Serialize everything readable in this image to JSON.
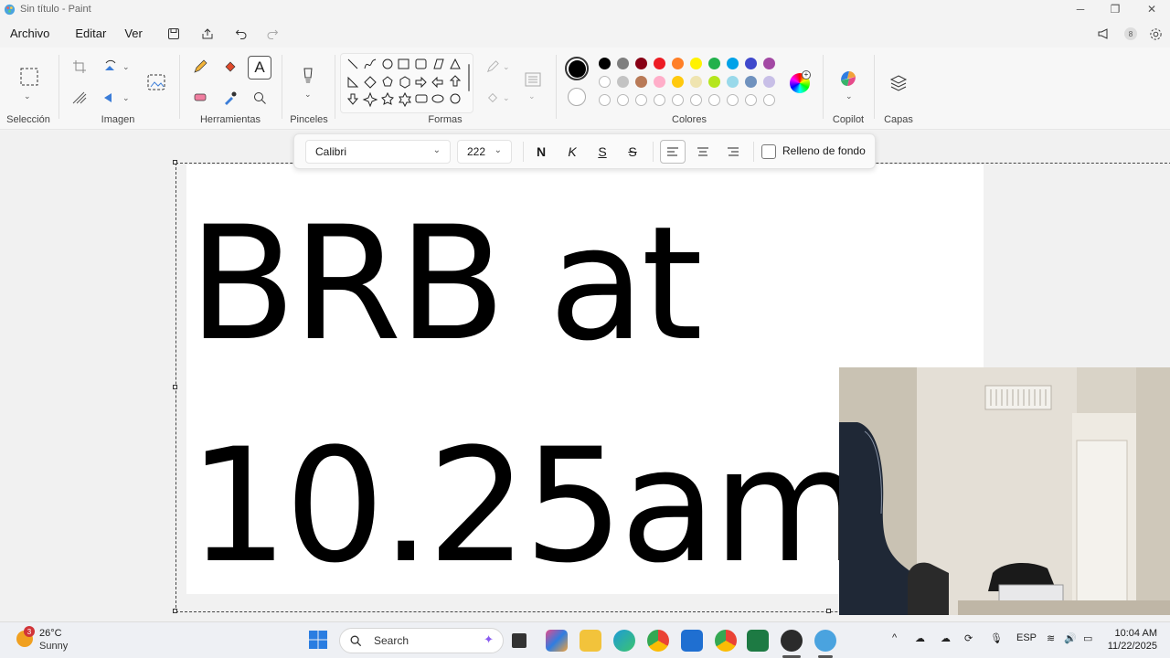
{
  "window": {
    "title": "Sin título - Paint"
  },
  "menu": {
    "items": [
      "Archivo",
      "Editar",
      "Ver"
    ]
  },
  "ribbon": {
    "groups": {
      "selection": "Selección",
      "image": "Imagen",
      "tools": "Herramientas",
      "brushes": "Pinceles",
      "shapes": "Formas",
      "colors": "Colores",
      "copilot": "Copilot",
      "layers": "Capas"
    },
    "palette_row1": [
      "#000000",
      "#7f7f7f",
      "#880015",
      "#ed1c24",
      "#ff7f27",
      "#fff200",
      "#22b14c",
      "#00a2e8",
      "#3f48cc",
      "#a349a4"
    ],
    "palette_row2": [
      "#ffffff",
      "#c3c3c3",
      "#b97a57",
      "#ffaec9",
      "#ffc90e",
      "#efe4b0",
      "#b5e61d",
      "#99d9ea",
      "#7092be",
      "#c8bfe7"
    ],
    "primary_color": "#000000",
    "secondary_color": "#ffffff"
  },
  "text_toolbar": {
    "font": "Calibri",
    "size": "222",
    "bold_label": "N",
    "italic_label": "K",
    "underline_label": "S",
    "strike_label": "S",
    "fill_label": "Relleno de fondo",
    "fill_checked": false
  },
  "canvas": {
    "line1": "BRB at",
    "line2": "10.25am"
  },
  "taskbar": {
    "weather_temp": "26°C",
    "weather_desc": "Sunny",
    "weather_badge": "3",
    "search_placeholder": "Search",
    "language": "ESP",
    "time": "10:04 AM",
    "date": "11/22/2025",
    "notification_count": "8"
  }
}
